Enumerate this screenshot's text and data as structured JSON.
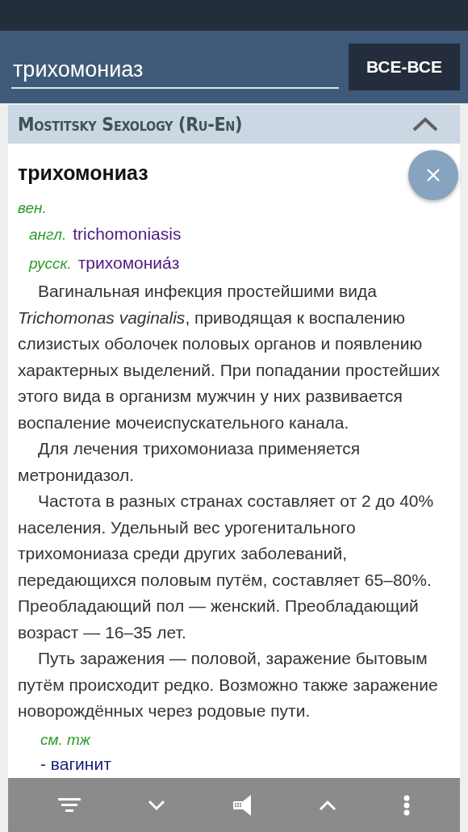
{
  "search": {
    "value": "трихомониаз"
  },
  "scope_button": {
    "label": "ВСЕ-ВСЕ"
  },
  "dictionary": {
    "title": "Mostitsky Sexology (Ru-En)",
    "expanded": true
  },
  "entry": {
    "headword": "трихомониаз",
    "label": "вен.",
    "translations": [
      {
        "lang": "англ.",
        "term": "trichomoniasis"
      },
      {
        "lang": "русск.",
        "term": "трихомониа́з"
      }
    ],
    "paragraphs": [
      "Вагинальная инфекция простейшими вида *Trichomonas vaginalis*, приводящая к воспалению слизистых оболочек половых органов и появлению характерных выделений. При попадании простейших этого вида в организм мужчин у них развивается воспаление мочеиспускательного канала.",
      "Для лечения трихомониаза применяется метронидазол.",
      "Частота в разных странах составляет от 2 до 40% населения. Удельный вес урогенитального трихомониаза среди других заболеваний, передающихся половым путём, составляет 65–80%. Преобладающий пол — женский. Преобладающий возраст — 16–35 лет.",
      "Путь заражения — половой, заражение бытовым путём происходит редко. Возможно также заражение новорождённых через родовые пути."
    ],
    "see_also_label": "см. тж",
    "see_also": [
      "- вагинит"
    ]
  }
}
